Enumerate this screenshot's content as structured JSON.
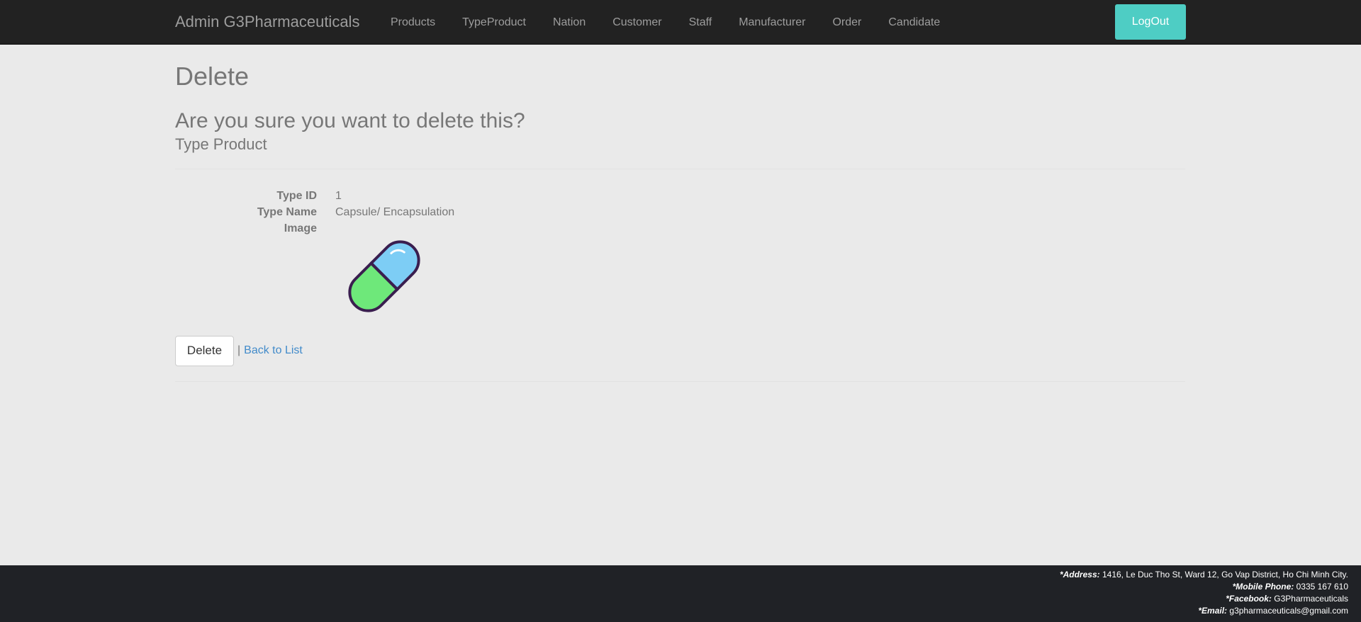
{
  "navbar": {
    "brand": "Admin G3Pharmaceuticals",
    "links": [
      "Products",
      "TypeProduct",
      "Nation",
      "Customer",
      "Staff",
      "Manufacturer",
      "Order",
      "Candidate"
    ],
    "logout_label": "LogOut"
  },
  "page": {
    "title": "Delete",
    "confirm": "Are you sure you want to delete this?",
    "entity": "Type Product"
  },
  "details": [
    {
      "label": "Type ID",
      "value": "1"
    },
    {
      "label": "Type Name",
      "value": "Capsule/ Encapsulation"
    },
    {
      "label": "Image",
      "value": ""
    }
  ],
  "image": {
    "icon": "capsule-icon"
  },
  "actions": {
    "delete_label": "Delete",
    "separator": "|",
    "back_label": "Back to List"
  },
  "footer": {
    "address_label": "*Address:",
    "address_value": "1416, Le Duc Tho St, Ward 12, Go Vap District, Ho Chi Minh City.",
    "phone_label": "*Mobile Phone:",
    "phone_value": "0335 167 610",
    "facebook_label": "*Facebook:",
    "facebook_value": "G3Pharmaceuticals",
    "email_label": "*Email:",
    "email_value": "g3pharmaceuticals@gmail.com"
  },
  "colors": {
    "navbar_bg": "#222222",
    "logout_bg": "#4ecdc4",
    "page_bg": "#eaeaea",
    "link": "#428bca",
    "footer_bg": "#202226"
  }
}
